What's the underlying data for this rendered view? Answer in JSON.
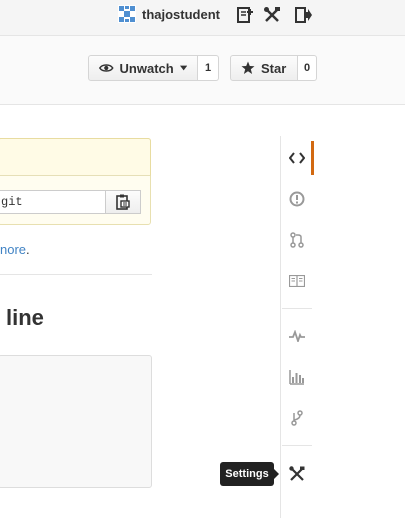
{
  "header": {
    "username": "thajostudent",
    "icons": [
      "avatar-icon",
      "new-repo-icon",
      "settings-icon",
      "sign-out-icon"
    ]
  },
  "repo_actions": {
    "watch_label": "Unwatch",
    "watch_count": "1",
    "star_label": "Star",
    "star_count": "0"
  },
  "clone": {
    "url_fragment": "git"
  },
  "content": {
    "more_link": "nore",
    "more_suffix": ".",
    "heading_fragment": "line"
  },
  "sidebar": {
    "items": [
      {
        "name": "code",
        "icon": "code-icon",
        "selected": true
      },
      {
        "name": "issues",
        "icon": "issue-icon",
        "selected": false
      },
      {
        "name": "pull-requests",
        "icon": "pull-request-icon",
        "selected": false
      },
      {
        "name": "wiki",
        "icon": "book-icon",
        "selected": false
      },
      {
        "name": "pulse",
        "icon": "pulse-icon",
        "selected": false
      },
      {
        "name": "graphs",
        "icon": "graph-icon",
        "selected": false
      },
      {
        "name": "network",
        "icon": "fork-icon",
        "selected": false
      },
      {
        "name": "settings",
        "icon": "tools-icon",
        "selected": false
      }
    ],
    "tooltip": "Settings"
  },
  "colors": {
    "selected_accent": "#d26911",
    "link": "#4183c4",
    "avatar": "#4f8fd1"
  }
}
